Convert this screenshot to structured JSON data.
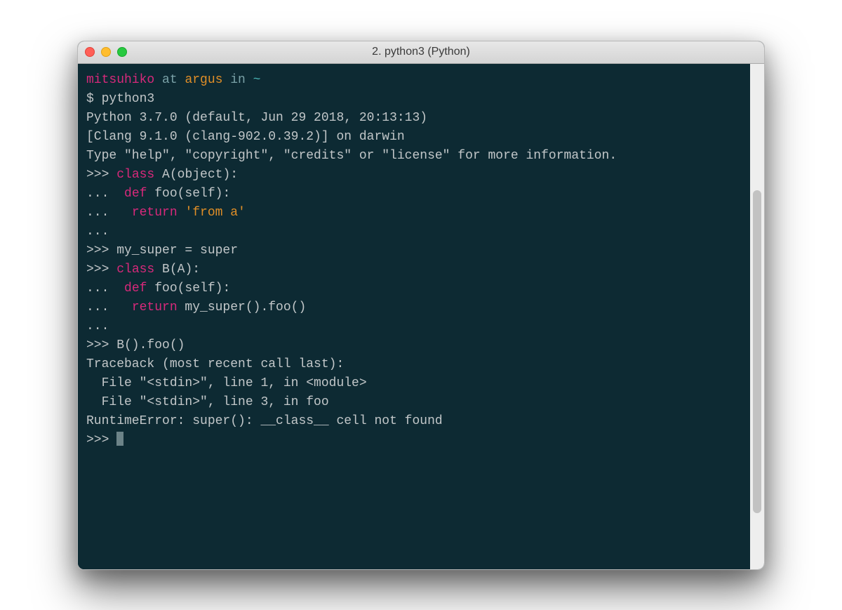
{
  "window": {
    "title": "2. python3 (Python)"
  },
  "prompt": {
    "user": "mitsuhiko",
    "at": " at ",
    "host": "argus",
    "in": " in ",
    "path": "~"
  },
  "lines": {
    "cmd": "$ python3",
    "banner1": "Python 3.7.0 (default, Jun 29 2018, 20:13:13)",
    "banner2": "[Clang 9.1.0 (clang-902.0.39.2)] on darwin",
    "banner3": "Type \"help\", \"copyright\", \"credits\" or \"license\" for more information.",
    "l1a": ">>> ",
    "l1b": "class",
    "l1c": " A(object):",
    "l2a": "...  ",
    "l2b": "def",
    "l2c": " foo(self):",
    "l3a": "...   ",
    "l3b": "return",
    "l3c": " ",
    "l3d": "'from a'",
    "l4": "...",
    "l5": ">>> my_super = super",
    "l6a": ">>> ",
    "l6b": "class",
    "l6c": " B(A):",
    "l7a": "...  ",
    "l7b": "def",
    "l7c": " foo(self):",
    "l8a": "...   ",
    "l8b": "return",
    "l8c": " my_super().foo()",
    "l9": "...",
    "l10": ">>> B().foo()",
    "tb1": "Traceback (most recent call last):",
    "tb2": "  File \"<stdin>\", line 1, in <module>",
    "tb3": "  File \"<stdin>\", line 3, in foo",
    "tb4": "RuntimeError: super(): __class__ cell not found",
    "finalPrompt": ">>> "
  }
}
